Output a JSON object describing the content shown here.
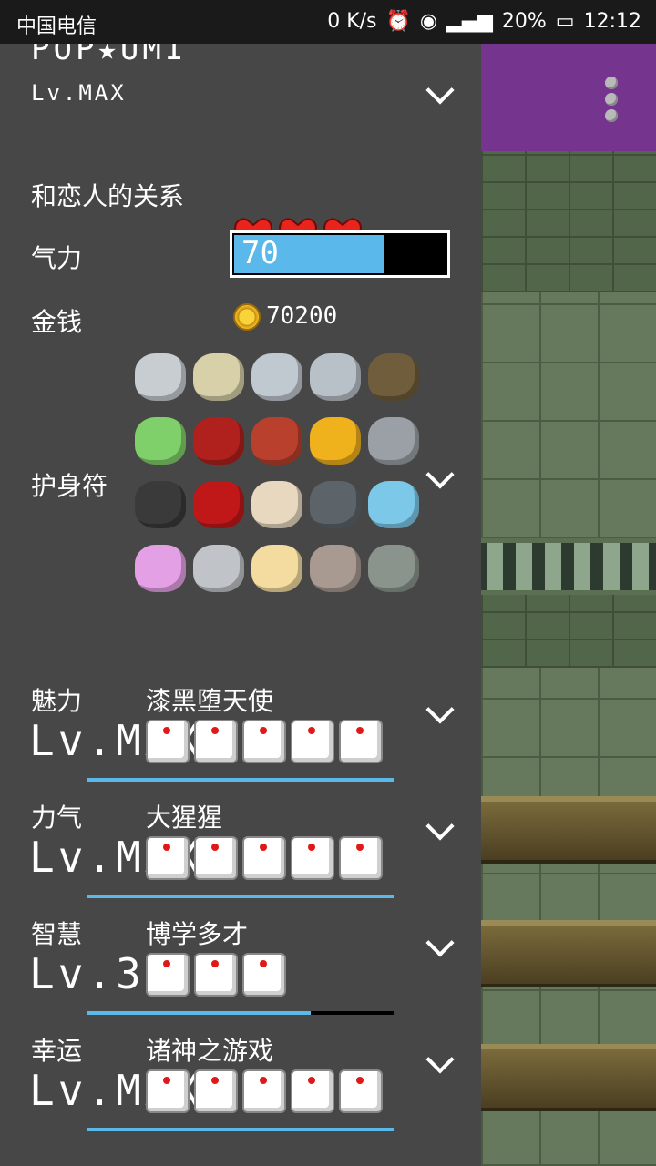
{
  "status_bar": {
    "carrier": "中国电信",
    "speed": "0 K/s",
    "icons": [
      "alarm-icon",
      "eye-icon",
      "signal-icon"
    ],
    "battery": "20%",
    "time": "12:12"
  },
  "character": {
    "name": "POP★UMI",
    "level": "Lv.MAX"
  },
  "relationship": {
    "label": "和恋人的关系",
    "hearts": 3
  },
  "energy": {
    "label": "气力",
    "value": "70",
    "fraction": 0.7
  },
  "money": {
    "label": "金钱",
    "amount": "70200"
  },
  "charms": {
    "label": "护身符",
    "items": [
      {
        "name": "fish-icon",
        "color": "#c8cdd2"
      },
      {
        "name": "yellowtail-icon",
        "color": "#d8d0a8"
      },
      {
        "name": "fish-icon",
        "color": "#c0c8d0"
      },
      {
        "name": "fish-icon",
        "color": "#b8c0c8"
      },
      {
        "name": "branch-icon",
        "color": "#6f5d3b"
      },
      {
        "name": "tiara-icon",
        "color": "#7fd06a"
      },
      {
        "name": "red-hood-icon",
        "color": "#b0201c"
      },
      {
        "name": "whip-icon",
        "color": "#b8402c"
      },
      {
        "name": "amber-icon",
        "color": "#f0b21c"
      },
      {
        "name": "sword-icon",
        "color": "#9aa0a6"
      },
      {
        "name": "bat-icon",
        "color": "#3a3a3a"
      },
      {
        "name": "ladybug-icon",
        "color": "#c01818"
      },
      {
        "name": "ticket-icon",
        "color": "#e8d8c0"
      },
      {
        "name": "stone-disc-icon",
        "color": "#5c646a"
      },
      {
        "name": "whale-icon",
        "color": "#7cc8e8"
      },
      {
        "name": "pink-slime-icon",
        "color": "#e4a0e4"
      },
      {
        "name": "crown-icon",
        "color": "#c0c4c8"
      },
      {
        "name": "puppy-icon",
        "color": "#f4dca0"
      },
      {
        "name": "fossil-icon",
        "color": "#a89a90"
      },
      {
        "name": "bell-icon",
        "color": "#8a948c"
      }
    ]
  },
  "stats": [
    {
      "name": "魅力",
      "title": "漆黑堕天使",
      "level": "Lv.MAX",
      "dice": 5,
      "progress": 1.0
    },
    {
      "name": "力气",
      "title": "大猩猩",
      "level": "Lv.MAX",
      "dice": 5,
      "progress": 1.0
    },
    {
      "name": "智慧",
      "title": "博学多才",
      "level": "Lv.3",
      "dice": 3,
      "progress": 0.73
    },
    {
      "name": "幸运",
      "title": "诸神之游戏",
      "level": "Lv.MAX",
      "dice": 5,
      "progress": 1.0
    }
  ],
  "colors": {
    "accent": "#5ab8ea",
    "panel": "#474747",
    "topbar": "#75358f",
    "heart": "#e8241c"
  }
}
